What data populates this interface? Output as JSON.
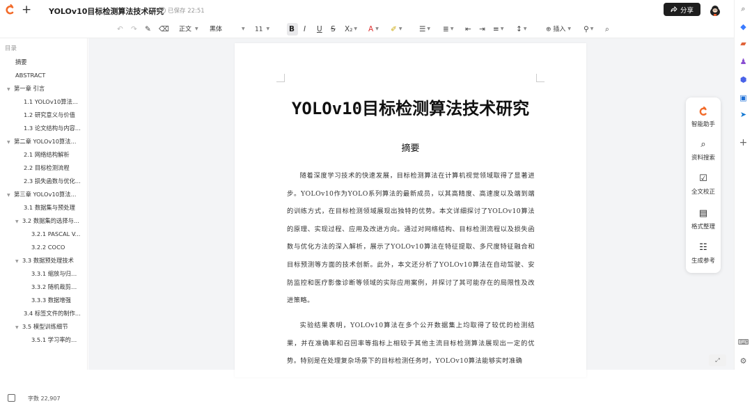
{
  "header": {
    "doc_title": "YOLOv10目标检测算法技术研究",
    "saved_status": "已保存 22:51",
    "share_label": "分享",
    "new_icon": "plus-icon"
  },
  "toolbar": {
    "style_select": "正文",
    "font_select": "黑体",
    "size_select": "11",
    "insert_label": "插入"
  },
  "sidebar": {
    "heading": "目录",
    "items": [
      {
        "label": "摘要"
      },
      {
        "label": "ABSTRACT"
      },
      {
        "label": "第一章 引言"
      },
      {
        "label": "1.1 YOLOv10算法..."
      },
      {
        "label": "1.2 研究意义与价值"
      },
      {
        "label": "1.3 论文结构与内容..."
      },
      {
        "label": "第二章 YOLOv10算法..."
      },
      {
        "label": "2.1 网络结构解析"
      },
      {
        "label": "2.2 目标检测流程"
      },
      {
        "label": "2.3 损失函数与优化..."
      },
      {
        "label": "第三章 YOLOv10算法..."
      },
      {
        "label": "3.1 数据集与预处理"
      },
      {
        "label": "3.2 数据集的选择与..."
      },
      {
        "label": "3.2.1 PASCAL V..."
      },
      {
        "label": "3.2.2 COCO"
      },
      {
        "label": "3.3 数据预处理技术"
      },
      {
        "label": "3.3.1 缩放与归一..."
      },
      {
        "label": "3.3.2 随机裁剪与..."
      },
      {
        "label": "3.3.3 数据增强"
      },
      {
        "label": "3.4 标签文件的制作..."
      },
      {
        "label": "3.5 模型训练细节"
      },
      {
        "label": "3.5.1 学习率的选..."
      }
    ],
    "word_count": "字数 22,907"
  },
  "document": {
    "title": "YOLOv10目标检测算法技术研究",
    "section_heading": "摘要",
    "paragraph1": "随着深度学习技术的快速发展，目标检测算法在计算机视觉领域取得了显著进步。YOLOv10作为YOLO系列算法的最新成员，以其高精度、高速度以及端到端的训练方式，在目标检测领域展现出独特的优势。本文详细探讨了YOLOv10算法的原理、实现过程、应用及改进方向。通过对网络结构、目标检测流程以及损失函数与优化方法的深入解析，展示了YOLOv10算法在特征提取、多尺度特征融合和目标预测等方面的技术创新。此外，本文还分析了YOLOv10算法在自动驾驶、安防监控和医疗影像诊断等领域的实际应用案例，并探讨了其可能存在的局限性及改进策略。",
    "paragraph2": "实验结果表明，YOLOv10算法在多个公开数据集上均取得了较优的检测结果，并在准确率和召回率等指标上相较于其他主流目标检测算法展现出一定的优势。特别是在处理复杂场景下的目标检测任务时，YOLOv10算法能够实时准确"
  },
  "assistant": {
    "items": [
      {
        "label": "智能助手"
      },
      {
        "label": "资料搜索"
      },
      {
        "label": "全文校正"
      },
      {
        "label": "格式整理"
      },
      {
        "label": "生成参考"
      }
    ]
  },
  "colors": {
    "brand": "#f26b2a",
    "share_bg": "#1e1e1e"
  }
}
